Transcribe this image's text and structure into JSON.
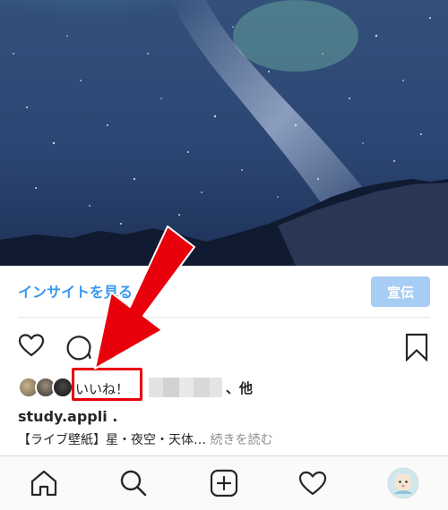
{
  "photo": {
    "description_icon": "aurora-night-sky-image"
  },
  "insights": {
    "link_label": "インサイトを見る",
    "promote_label": "宣伝"
  },
  "actions": {
    "like_icon": "heart-icon",
    "comment_icon": "comment-bubble-icon",
    "save_icon": "bookmark-icon"
  },
  "likes": {
    "label": "いいね！",
    "others": "、他"
  },
  "post": {
    "username": "study.appli .",
    "caption": "【ライブ壁紙】星・夜空・天体…",
    "more": "続きを読む"
  },
  "bottom_nav": {
    "items": [
      {
        "icon": "home-icon"
      },
      {
        "icon": "search-icon"
      },
      {
        "icon": "add-post-icon"
      },
      {
        "icon": "activity-heart-icon"
      },
      {
        "icon": "profile-avatar-icon"
      }
    ]
  },
  "colors": {
    "link": "#3897f0",
    "promote_bg": "#a8cdf4",
    "annotation": "#e8000b",
    "text": "#262626",
    "muted": "#8e8e8e"
  }
}
